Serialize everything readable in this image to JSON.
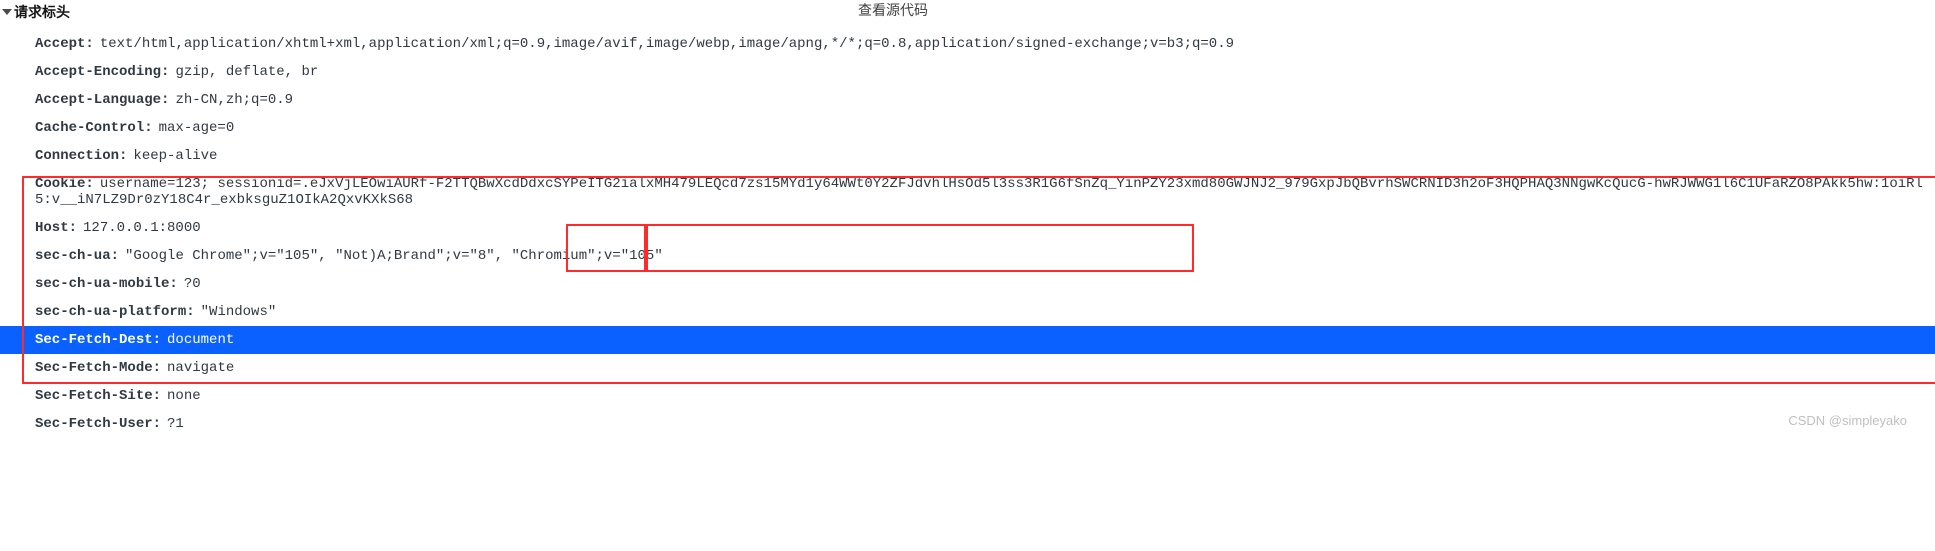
{
  "section": {
    "title": "请求标头",
    "view_source": "查看源代码"
  },
  "headers": [
    {
      "k": "Accept",
      "v": "text/html,application/xhtml+xml,application/xml;q=0.9,image/avif,image/webp,image/apng,*/*;q=0.8,application/signed-exchange;v=b3;q=0.9"
    },
    {
      "k": "Accept-Encoding",
      "v": "gzip, deflate, br"
    },
    {
      "k": "Accept-Language",
      "v": "zh-CN,zh;q=0.9"
    },
    {
      "k": "Cache-Control",
      "v": "max-age=0"
    },
    {
      "k": "Connection",
      "v": "keep-alive"
    },
    {
      "k": "Cookie",
      "v": "username=123; sessionid=.eJxVjLEOwiAURf-F2TTQBwXcdDdxcSYPeITG2ialxMH479LEQcd7zs15MYd1y64WWt0Y2ZFJdvhlHsOd5l3ss3R1G6fSnZq_YinPZY23xmd80GWJNJ2_979GxpJbQBvrhSWCRNID3h2oF3HQPHAQ3NNgwKcQucG-hwRJWWG1l6C1UFaRZO8PAkk5hw:1oiRl5:v__iN7LZ9Dr0zY18C4r_exbksguZ1OIkA2QxvKXkS68"
    },
    {
      "k": "Host",
      "v": "127.0.0.1:8000"
    },
    {
      "k": "sec-ch-ua",
      "v": "\"Google Chrome\";v=\"105\", \"Not)A;Brand\";v=\"8\", \"Chromium\";v=\"105\""
    },
    {
      "k": "sec-ch-ua-mobile",
      "v": "?0"
    },
    {
      "k": "sec-ch-ua-platform",
      "v": "\"Windows\""
    },
    {
      "k": "Sec-Fetch-Dest",
      "v": "document",
      "highlight": true
    },
    {
      "k": "Sec-Fetch-Mode",
      "v": "navigate"
    },
    {
      "k": "Sec-Fetch-Site",
      "v": "none"
    },
    {
      "k": "Sec-Fetch-User",
      "v": "?1"
    }
  ],
  "watermark": "CSDN @simpleyako"
}
